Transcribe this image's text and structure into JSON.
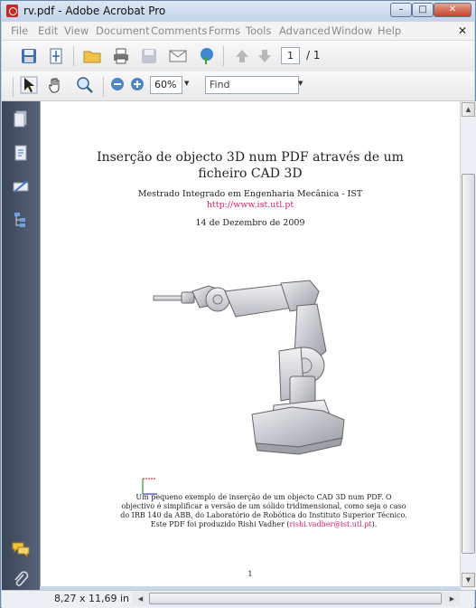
{
  "window": {
    "title": "rv.pdf - Adobe Acrobat Pro",
    "controls": {
      "minimize": "–",
      "maximize": "□",
      "close": "✕"
    }
  },
  "menubar": {
    "items": [
      "File",
      "Edit",
      "View",
      "Document",
      "Comments",
      "Forms",
      "Tools",
      "Advanced",
      "Window",
      "Help"
    ],
    "close_glyph": "✕"
  },
  "toolbar": {
    "icons": [
      "save-icon",
      "fit-page-icon",
      "open-folder-icon",
      "print-icon",
      "disk-icon",
      "email-icon",
      "globe-upload-icon",
      "previous-page-icon",
      "next-page-icon"
    ],
    "page_current": "1",
    "page_total": "/ 1"
  },
  "toolbar2": {
    "icons": [
      "select-cursor-icon",
      "hand-tool-icon",
      "zoom-tool-icon",
      "zoom-out-icon",
      "zoom-in-icon"
    ],
    "zoom": "60%",
    "find_placeholder": "Find"
  },
  "nav_pane": {
    "icons": [
      "pages-icon",
      "attachments-page-icon",
      "signatures-icon",
      "model-tree-icon",
      "comments-icon",
      "paperclip-icon"
    ]
  },
  "document": {
    "title_line1": "Inserção de objecto 3D num PDF através de um",
    "title_line2": "ficheiro CAD 3D",
    "author": "Mestrado Integrado em Engenharia Mecânica - IST",
    "url": "http://www.ist.utl.pt",
    "date": "14 de Dezembro de 2009",
    "caption_line1": "Um pequeno exemplo de inserção de um objecto CAD 3D num PDF. O",
    "caption_line2": "objectivo é simplificar a versão de um sólido tridimensional, como seja o caso",
    "caption_line3": "do IRB 140 da ABB, do Laboratório de Robótica do Instituto Superior Técnico.",
    "caption_line4_pre": "Este PDF foi produzido Rishi Vadher (",
    "caption_email": "rishi.vadher@ist.utl.pt",
    "caption_line4_post": ").",
    "page_number": "1"
  },
  "status": {
    "page_size": "8,27 x 11,69 in"
  },
  "colors": {
    "link": "#d8246b",
    "nav_pane": "#3a4556"
  }
}
